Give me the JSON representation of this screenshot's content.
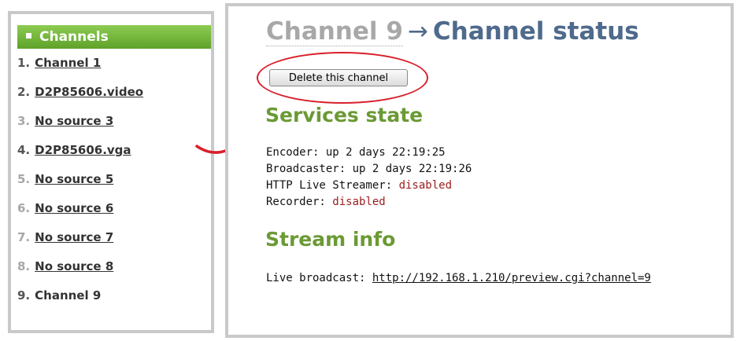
{
  "sidebar": {
    "header": "Channels",
    "items": [
      {
        "num": "1.",
        "label": "Channel 1",
        "active": true,
        "current": false
      },
      {
        "num": "2.",
        "label": "D2P85606.video",
        "active": true,
        "current": false
      },
      {
        "num": "3.",
        "label": "No source 3",
        "active": false,
        "current": false
      },
      {
        "num": "4.",
        "label": "D2P85606.vga",
        "active": true,
        "current": false
      },
      {
        "num": "5.",
        "label": "No source 5",
        "active": false,
        "current": false
      },
      {
        "num": "6.",
        "label": "No source 6",
        "active": false,
        "current": false
      },
      {
        "num": "7.",
        "label": "No source 7",
        "active": false,
        "current": false
      },
      {
        "num": "8.",
        "label": "No source 8",
        "active": false,
        "current": false
      },
      {
        "num": "9.",
        "label": "Channel 9",
        "active": true,
        "current": true
      }
    ]
  },
  "main": {
    "title_channel": "Channel 9",
    "title_arrow": "→",
    "title_page": "Channel status",
    "delete_button": "Delete this channel",
    "services_heading": "Services state",
    "services": [
      {
        "label": "Encoder: ",
        "value": "up 2 days 22:19:25",
        "status": "ok"
      },
      {
        "label": "Broadcaster: ",
        "value": "up 2 days 22:19:26",
        "status": "ok"
      },
      {
        "label": "HTTP Live Streamer: ",
        "value": "disabled",
        "status": "disabled"
      },
      {
        "label": "Recorder: ",
        "value": "disabled",
        "status": "disabled"
      }
    ],
    "stream_heading": "Stream info",
    "live_broadcast_label": "Live broadcast: ",
    "live_broadcast_url": "http://192.168.1.210/preview.cgi?channel=9"
  },
  "colors": {
    "header_green": "#6fb23b",
    "heading_green": "#6b9a34",
    "title_blue": "#4e6a8c",
    "disabled_red": "#9a1c1c",
    "annotation_red": "#d8202b"
  },
  "icons": {
    "header_bullet": "square-bullet-icon",
    "annotation_arrow": "curved-arrow-icon"
  }
}
